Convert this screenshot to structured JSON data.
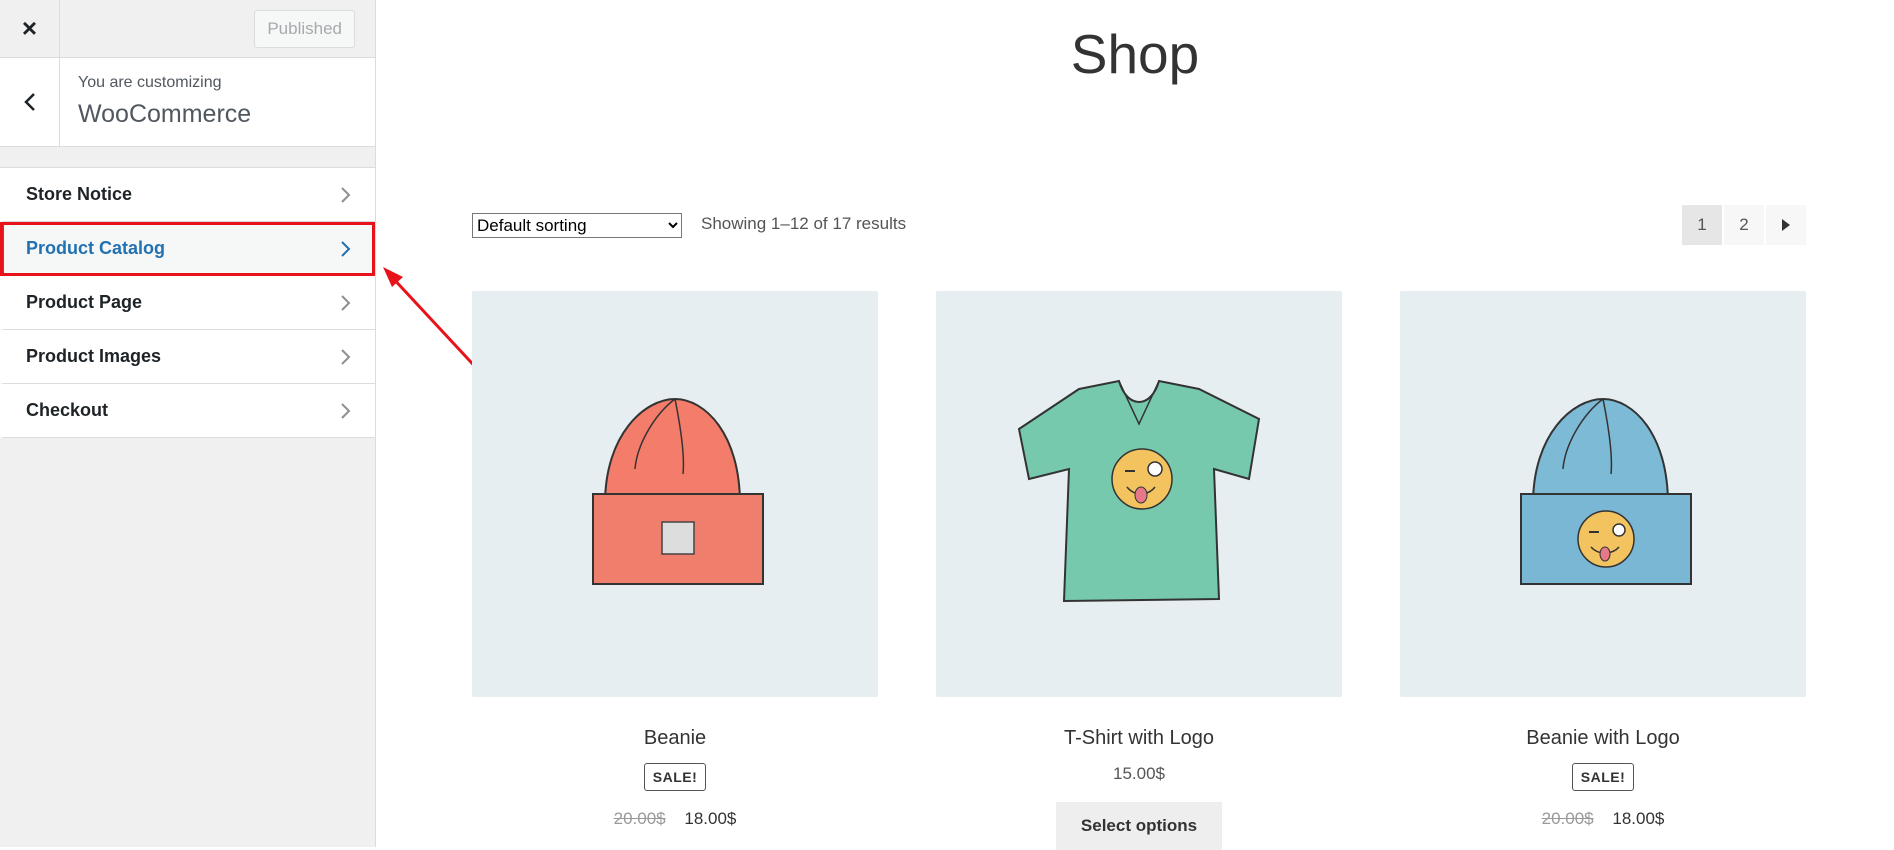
{
  "customizer": {
    "close_label": "×",
    "publish_label": "Published",
    "context_sub": "You are customizing",
    "context_title": "WooCommerce",
    "panels": [
      {
        "label": "Store Notice"
      },
      {
        "label": "Product Catalog"
      },
      {
        "label": "Product Page"
      },
      {
        "label": "Product Images"
      },
      {
        "label": "Checkout"
      }
    ]
  },
  "shop": {
    "title": "Shop",
    "sorting": "Default sorting",
    "result_count": "Showing 1–12 of 17 results",
    "pages": [
      "1",
      "2"
    ],
    "products": [
      {
        "name": "Beanie",
        "badge": "SALE!",
        "old_price": "20.00$",
        "price": "18.00$"
      },
      {
        "name": "T-Shirt with Logo",
        "price": "15.00$",
        "button": "Select options"
      },
      {
        "name": "Beanie with Logo",
        "badge": "SALE!",
        "old_price": "20.00$",
        "price": "18.00$"
      }
    ]
  },
  "colors": {
    "accent": "#2271b1",
    "highlight": "#e8121a"
  },
  "icons": [
    "close-icon",
    "back-icon",
    "chevron-right-icon",
    "next-page-icon"
  ]
}
